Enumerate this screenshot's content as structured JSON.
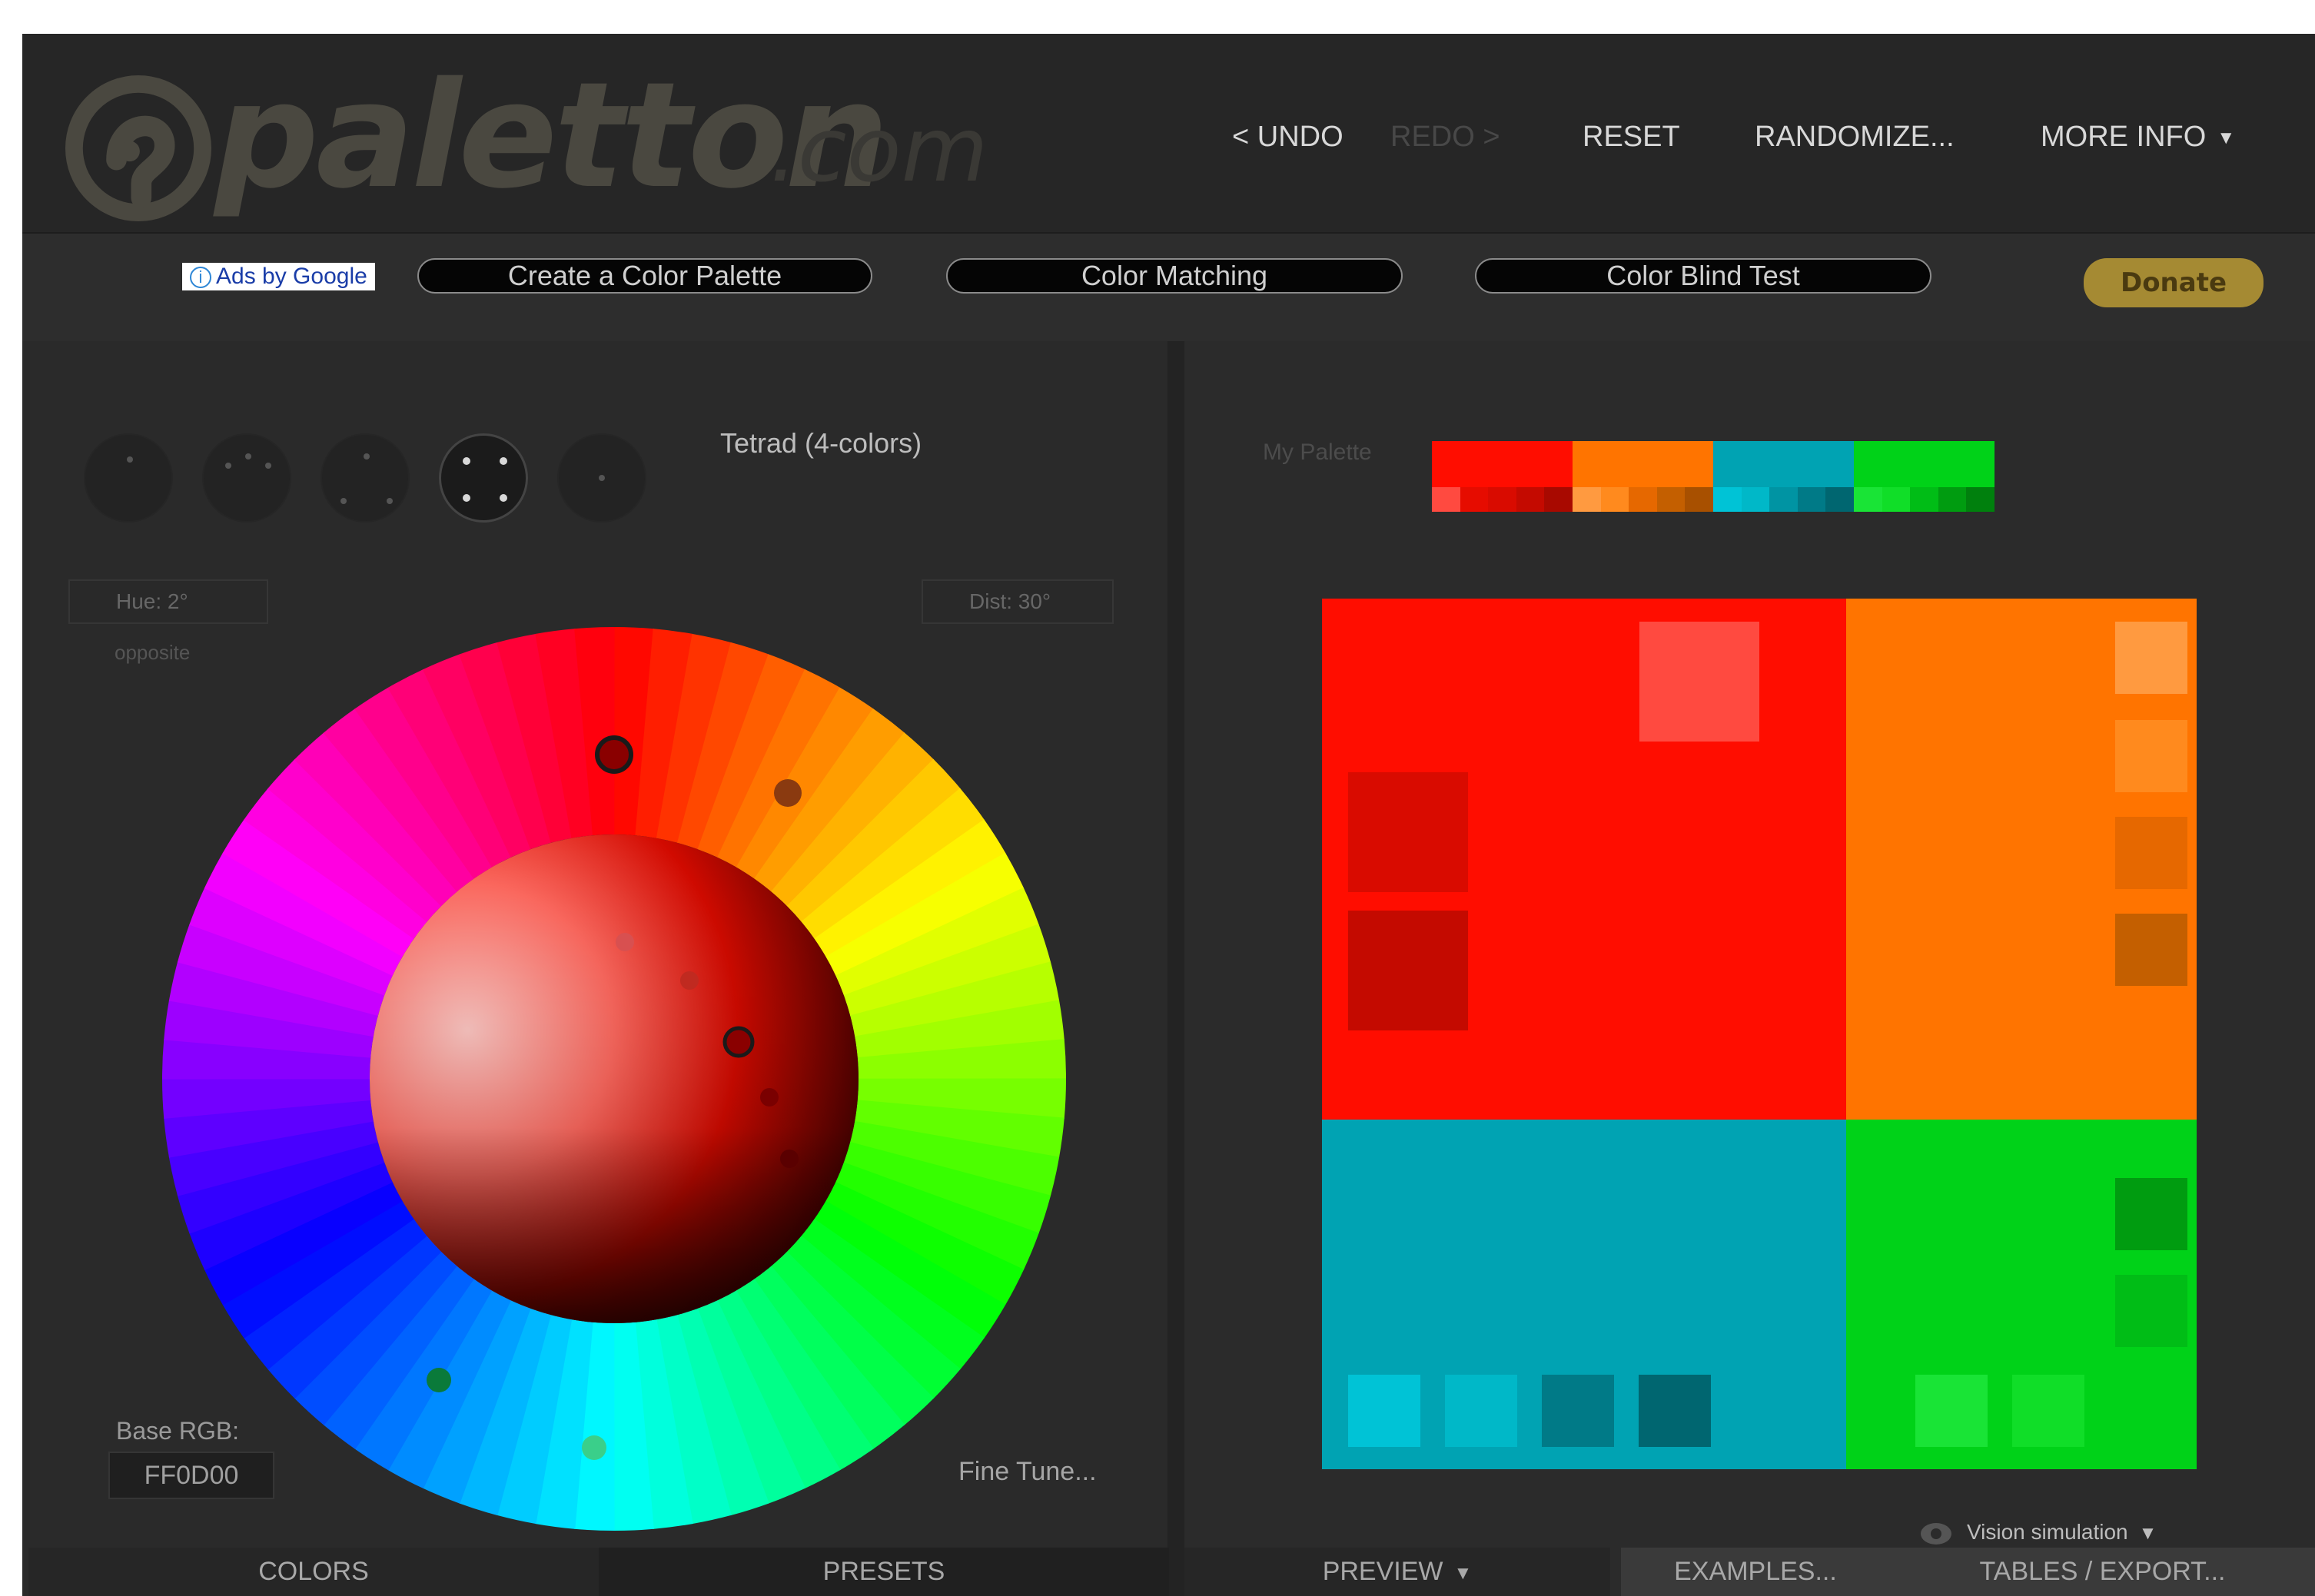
{
  "brand": {
    "name": "paletton",
    "tld": ".com"
  },
  "topnav": {
    "undo": "< UNDO",
    "redo": "REDO >",
    "reset": "RESET",
    "randomize": "RANDOMIZE...",
    "more_info": "MORE INFO",
    "more_info_icon": "caret-down-icon"
  },
  "subnav": {
    "ads_icon": "info-icon",
    "ads": "Ads by Google",
    "create": "Create a Color Palette",
    "matching": "Color Matching",
    "blind": "Color Blind Test",
    "donate": "Donate"
  },
  "left": {
    "modes": [
      {
        "name": "mono",
        "icon": "mono-mode-icon"
      },
      {
        "name": "adjacent",
        "icon": "adjacent-mode-icon"
      },
      {
        "name": "triad",
        "icon": "triad-mode-icon"
      },
      {
        "name": "tetrad",
        "icon": "tetrad-mode-icon",
        "active": true
      },
      {
        "name": "free",
        "icon": "free-style-mode-icon"
      }
    ],
    "scheme_label": "Tetrad (4-colors)",
    "hue_field": "Hue: 2°",
    "hue_sub": "opposite",
    "dist_field": "Dist: 30°",
    "base_rgb_label": "Base RGB:",
    "base_rgb_value": "FF0D00",
    "fine_tune": "Fine Tune..."
  },
  "right": {
    "my_palette_label": "My Palette",
    "palette": [
      {
        "main": "#ff0d00",
        "shades": [
          "#ff4a40",
          "#e60c00",
          "#d90b00",
          "#c40a00",
          "#a80900"
        ]
      },
      {
        "main": "#ff7400",
        "shades": [
          "#ff9a40",
          "#ff8a1e",
          "#e66800",
          "#c45f00",
          "#a85000"
        ]
      },
      {
        "main": "#00a3b3",
        "shades": [
          "#00c3d6",
          "#00b8c8",
          "#0094a3",
          "#007a87",
          "#006670"
        ]
      },
      {
        "main": "#00d218",
        "shades": [
          "#19e436",
          "#10de28",
          "#00bd16",
          "#009c10",
          "#00800d"
        ]
      }
    ],
    "vision_icon": "eye-icon",
    "vision": "Vision simulation",
    "vision_caret_icon": "caret-down-icon"
  },
  "tabs": {
    "colors": "COLORS",
    "presets": "PRESETS",
    "preview": "PREVIEW",
    "preview_icon": "caret-down-icon",
    "examples": "EXAMPLES...",
    "tables": "TABLES / EXPORT..."
  },
  "accent": "#ff0d00"
}
